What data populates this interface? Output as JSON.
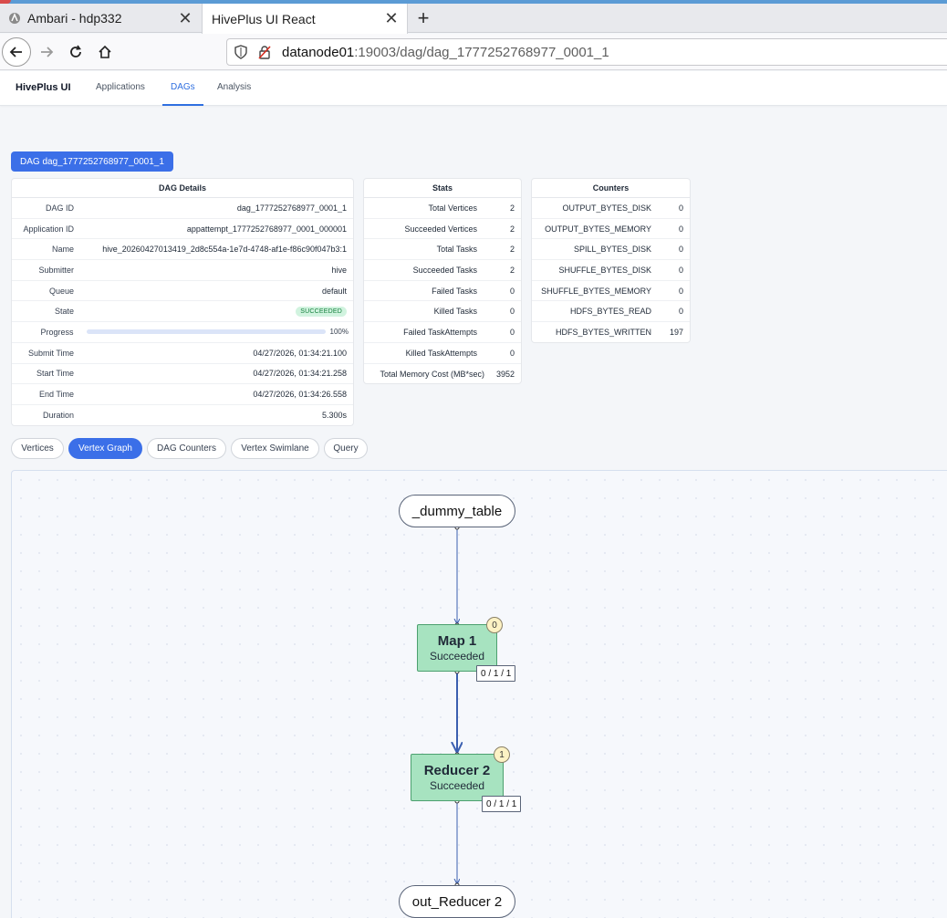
{
  "browser": {
    "tabs": [
      {
        "title": "Ambari - hdp332",
        "active": false
      },
      {
        "title": "HivePlus UI React",
        "active": true
      }
    ],
    "url": {
      "host": "datanode01",
      "path": ":19003/dag/dag_1777252768977_0001_1"
    }
  },
  "app": {
    "brand": "HivePlus UI",
    "nav": [
      {
        "label": "Applications",
        "active": false
      },
      {
        "label": "DAGs",
        "active": true
      },
      {
        "label": "Analysis",
        "active": false
      }
    ]
  },
  "dag_title": "DAG dag_1777252768977_0001_1",
  "details": {
    "header": "DAG Details",
    "rows": [
      {
        "k": "DAG ID",
        "v": "dag_1777252768977_0001_1"
      },
      {
        "k": "Application ID",
        "v": "appattempt_1777252768977_0001_000001"
      },
      {
        "k": "Name",
        "v": "hive_20260427013419_2d8c554a-1e7d-4748-af1e-f86c90f047b3:1"
      },
      {
        "k": "Submitter",
        "v": "hive"
      },
      {
        "k": "Queue",
        "v": "default"
      },
      {
        "k": "State",
        "v": "SUCCEEDED"
      },
      {
        "k": "Progress",
        "v": "100%",
        "progress": 1.0
      },
      {
        "k": "Submit Time",
        "v": "04/27/2026, 01:34:21.100"
      },
      {
        "k": "Start Time",
        "v": "04/27/2026, 01:34:21.258"
      },
      {
        "k": "End Time",
        "v": "04/27/2026, 01:34:26.558"
      },
      {
        "k": "Duration",
        "v": "5.300s"
      }
    ]
  },
  "stats": {
    "header": "Stats",
    "rows": [
      {
        "k": "Total Vertices",
        "v": "2"
      },
      {
        "k": "Succeeded Vertices",
        "v": "2"
      },
      {
        "k": "Total Tasks",
        "v": "2"
      },
      {
        "k": "Succeeded Tasks",
        "v": "2"
      },
      {
        "k": "Failed Tasks",
        "v": "0"
      },
      {
        "k": "Killed Tasks",
        "v": "0"
      },
      {
        "k": "Failed TaskAttempts",
        "v": "0"
      },
      {
        "k": "Killed TaskAttempts",
        "v": "0"
      },
      {
        "k": "Total Memory Cost (MB*sec)",
        "v": "3952"
      }
    ]
  },
  "counters": {
    "header": "Counters",
    "rows": [
      {
        "k": "OUTPUT_BYTES_DISK",
        "v": "0"
      },
      {
        "k": "OUTPUT_BYTES_MEMORY",
        "v": "0"
      },
      {
        "k": "SPILL_BYTES_DISK",
        "v": "0"
      },
      {
        "k": "SHUFFLE_BYTES_DISK",
        "v": "0"
      },
      {
        "k": "SHUFFLE_BYTES_MEMORY",
        "v": "0"
      },
      {
        "k": "HDFS_BYTES_READ",
        "v": "0"
      },
      {
        "k": "HDFS_BYTES_WRITTEN",
        "v": "197"
      }
    ]
  },
  "subtabs": [
    {
      "label": "Vertices",
      "active": false
    },
    {
      "label": "Vertex Graph",
      "active": true
    },
    {
      "label": "DAG Counters",
      "active": false
    },
    {
      "label": "Vertex Swimlane",
      "active": false
    },
    {
      "label": "Query",
      "active": false
    }
  ],
  "graph": {
    "source": "_dummy_table",
    "sink": "out_Reducer 2",
    "vertices": [
      {
        "name": "Map 1",
        "state": "Succeeded",
        "badge": "0",
        "tasks": "0 / 1 / 1"
      },
      {
        "name": "Reducer 2",
        "state": "Succeeded",
        "badge": "1",
        "tasks": "0 / 1 / 1"
      }
    ]
  },
  "colors": {
    "accent": "#3b6fe8",
    "vertex_fill": "#a7e3c0",
    "success_text": "#15803d"
  }
}
